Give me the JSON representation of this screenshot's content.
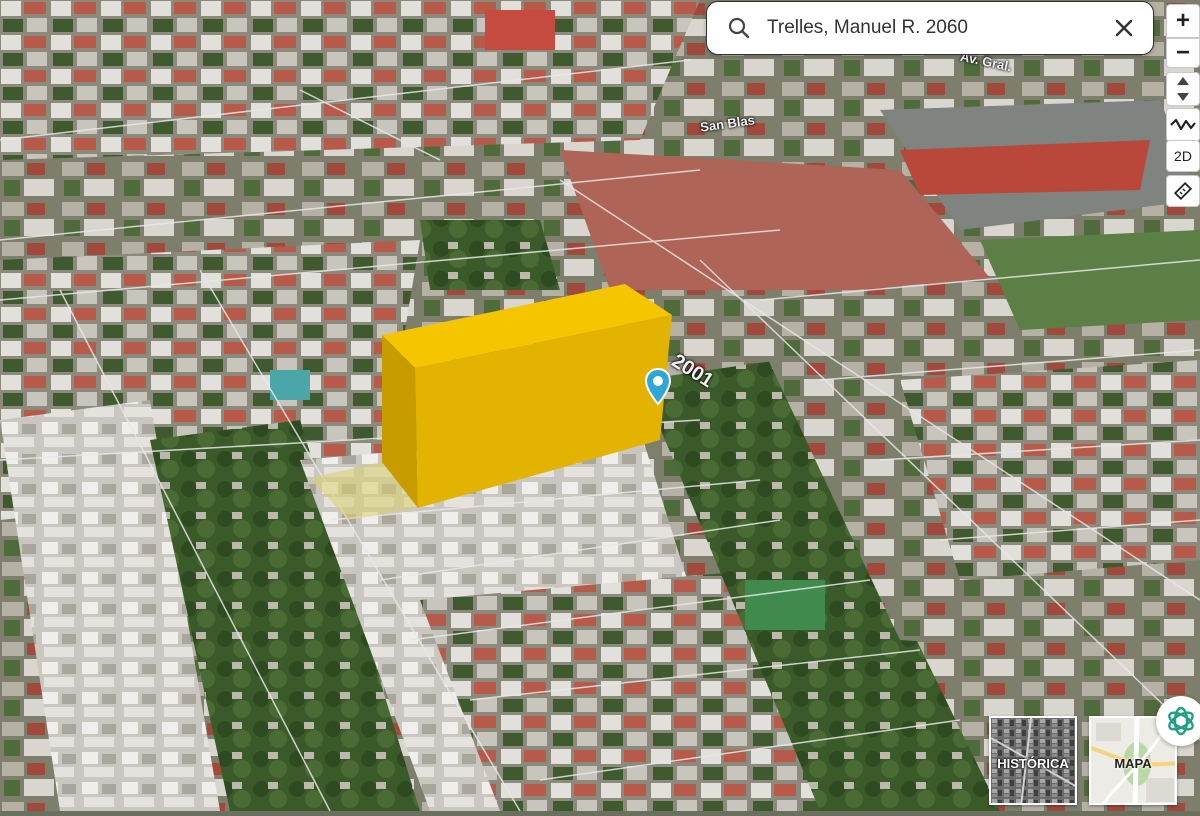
{
  "search": {
    "value": "Trelles, Manuel R. 2060",
    "placeholder": ""
  },
  "controls": {
    "zoom_in": "+",
    "zoom_out": "−",
    "view_2d": "2D"
  },
  "map": {
    "street_labels": [
      "2001",
      "San Blas",
      "Av. Gral."
    ],
    "marker_icon": "location-pin-icon",
    "highlight_color": "#f2c400"
  },
  "basemaps": [
    {
      "label": "HISTÓRICA"
    },
    {
      "label": "MAPA"
    }
  ],
  "icons": {
    "search": "search-icon",
    "close": "close-icon",
    "tilt": "tilt-icon",
    "terrain": "terrain-icon",
    "measure": "measure-icon",
    "assistant": "assistant-icon"
  }
}
